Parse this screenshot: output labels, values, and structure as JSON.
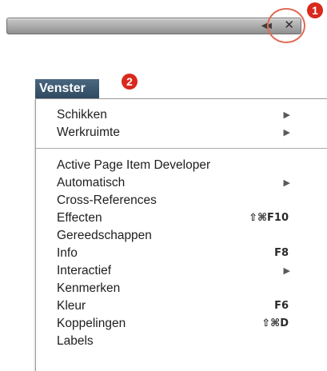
{
  "panel": {
    "collapse_glyph": "◀◀",
    "close_glyph": "✕",
    "icons": {
      "collapse": "double-left-arrow-icon",
      "close": "close-icon"
    }
  },
  "callouts": [
    "1",
    "2"
  ],
  "menu": {
    "title": "Venster",
    "group1": [
      {
        "label": "Schikken",
        "arrow": "▶"
      },
      {
        "label": "Werkruimte",
        "arrow": "▶"
      }
    ],
    "group2": [
      {
        "label": "Active Page Item Developer"
      },
      {
        "label": "Automatisch",
        "arrow": "▶"
      },
      {
        "label": "Cross-References"
      },
      {
        "label": "Effecten",
        "shortcut": "⇧⌘F10"
      },
      {
        "label": "Gereedschappen"
      },
      {
        "label": "Info",
        "shortcut": "F8"
      },
      {
        "label": "Interactief",
        "arrow": "▶"
      },
      {
        "label": "Kenmerken"
      },
      {
        "label": "Kleur",
        "shortcut": "F6"
      },
      {
        "label": "Koppelingen",
        "shortcut": "⇧⌘D"
      },
      {
        "label": "Labels"
      }
    ]
  },
  "colors": {
    "callout": "#d9281c",
    "highlight_ring": "#e06a55",
    "menu_title_bg": "#3b5670"
  }
}
